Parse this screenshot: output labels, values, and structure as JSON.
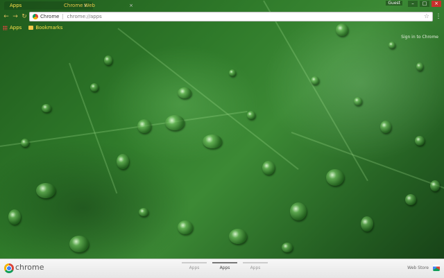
{
  "tabs": [
    {
      "label": "Apps",
      "close": "×"
    },
    {
      "label": "Chrome Web",
      "close": "×"
    }
  ],
  "window": {
    "profile": "Guest",
    "minimize": "–",
    "maximize": "□",
    "close": "×"
  },
  "toolbar": {
    "back": "←",
    "forward": "→",
    "reload": "↻",
    "star": "☆",
    "menu": "⋮"
  },
  "omnibox": {
    "chip": "Chrome",
    "url": "chrome://apps"
  },
  "bookmarks": [
    {
      "label": "Apps"
    },
    {
      "label": "Bookmarks"
    }
  ],
  "signin": "Sign in to Chrome",
  "bottom": {
    "brand": "chrome",
    "pages": [
      {
        "label": "Apps",
        "active": false
      },
      {
        "label": "Apps",
        "active": true
      },
      {
        "label": "Apps",
        "active": false
      }
    ],
    "webstore": "Web Store"
  }
}
